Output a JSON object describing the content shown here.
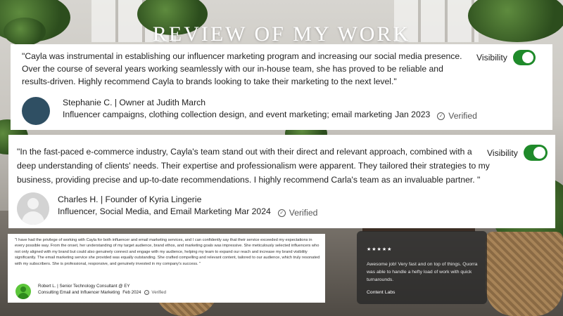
{
  "page": {
    "title": "REVIEW OF MY WORK"
  },
  "toggle": {
    "label": "Visibility",
    "on_color": "#1f8a2a",
    "on": true
  },
  "reviews": [
    {
      "quote": "\"Cayla was instrumental in establishing our influencer marketing program and increasing our social media presence. Over the course of several years working seamlessly with our in-house team, she has proved to be reliable and results-driven. Highly recommend Cayla to brands looking to take their marketing to the next level.\"",
      "author": "Stephanie C. | Owner at Judith March",
      "services": "Influencer campaigns, clothing collection design, and event marketing; email marketing",
      "date": "Jan 2023",
      "verified": "Verified",
      "avatar_color": "#2f4f63"
    },
    {
      "quote": "\"In the fast-paced e-commerce industry, Cayla's team stand out with their direct and relevant approach, combined with a deep understanding of clients' needs. Their expertise and professionalism were apparent. They tailored their strategies to my business, providing precise and up-to-date recommendations. I highly recommend Carla's team as an invaluable partner. \"",
      "author": "Charles H. | Founder of Kyria Lingerie",
      "services": "Influencer, Social Media, and Email Marketing",
      "date": "Mar 2024",
      "verified": "Verified",
      "avatar_color": "#d3d3d3"
    },
    {
      "quote": "\"I have had the privilege of working with Cayla for both influencer and email marketing services, and I can confidently say that their service exceeded my expectations in every possible way. From the onset, her understanding of my target audience, brand ethos, and marketing goals was impressive. She meticulously selected influencers who not only aligned with my brand but could also genuinely connect and engage with my audience, helping my team to expand our reach and increase my brand visibility significantly. The email marketing service she provided was equally outstanding. She crafted compelling and relevant content, tailored to our audience, which truly resonated with my subscribers. She is professional, responsive, and genuinely invested in my company's success. \"",
      "author": "Robert L. | Senior Technology Consultant @ EY",
      "services": "Consulting Email and Influencer Marketing",
      "date": "Feb 2024",
      "verified": "Verified",
      "avatar_color": "#5cc63a"
    }
  ],
  "testimonial": {
    "stars": "★★★★★",
    "rating": 5,
    "quote": "Awesome job! Very fast and on top of things. Quorra was able to handle a hefty load of work with quick turnarounds.",
    "author": "Content Labs"
  }
}
